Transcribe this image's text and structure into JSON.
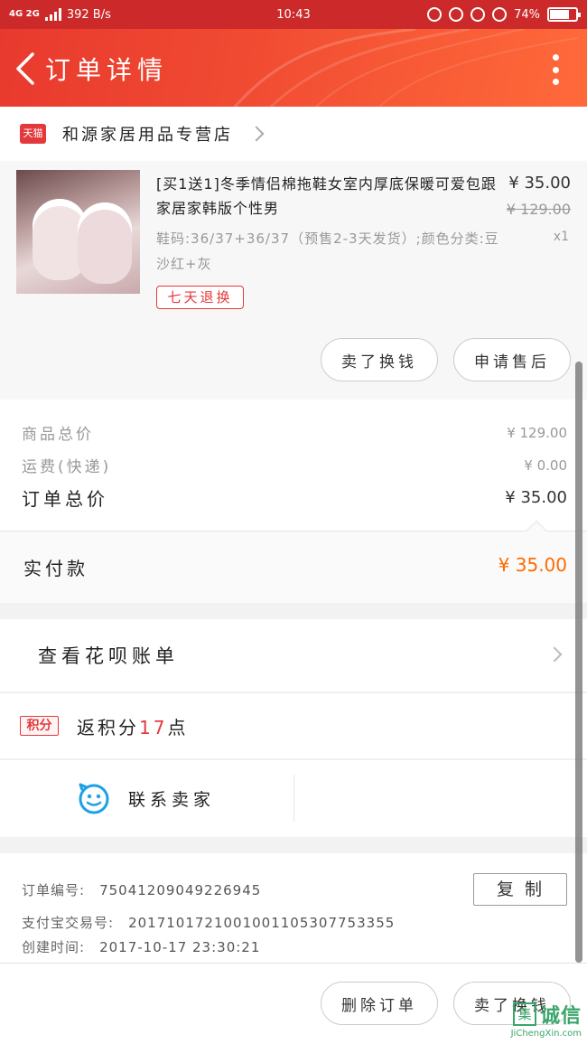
{
  "status_bar": {
    "network": "4G 2G",
    "speed": "392 B/s",
    "time": "10:43",
    "battery_text": "74%",
    "battery_level": 0.74
  },
  "header": {
    "title": "订单详情"
  },
  "shop": {
    "badge": "天猫",
    "name": "和源家居用品专营店"
  },
  "product": {
    "title": "[买1送1]冬季情侣棉拖鞋女室内厚底保暖可爱包跟家居家韩版个性男",
    "spec": "鞋码:36/37+36/37（预售2-3天发货）;颜色分类:豆沙红+灰",
    "price": "¥ 35.00",
    "original_price": "¥ 129.00",
    "quantity": "x1",
    "return_badge": "七天退换",
    "actions": [
      "卖了换钱",
      "申请售后"
    ]
  },
  "totals": {
    "goods_total_label": "商品总价",
    "goods_total": "¥ 129.00",
    "shipping_label": "运费(快递)",
    "shipping": "¥ 0.00",
    "order_total_label": "订单总价",
    "order_total": "¥ 35.00",
    "paid_label": "实付款",
    "paid": "¥ 35.00"
  },
  "huabei": {
    "label": "查看花呗账单"
  },
  "points": {
    "badge": "积分",
    "prefix": "返积分",
    "value": "17",
    "suffix": "点"
  },
  "contact": {
    "label": "联系卖家"
  },
  "order_info": {
    "order_no_label": "订单编号:",
    "order_no": "75041209049226945",
    "alipay_label": "支付宝交易号:",
    "alipay_no": "2017101721001001105307753355",
    "created_label": "创建时间:",
    "created": "2017-10-17 23:30:21",
    "copy_label": "复制"
  },
  "footer": {
    "delete_label": "删除订单",
    "resell_label": "卖了换钱"
  },
  "watermark": {
    "box": "集",
    "text": "诚信",
    "url": "JiChengXin.com"
  },
  "colors": {
    "header_red": "#e8392e",
    "tmall_red": "#e4393c",
    "paid_orange": "#ff6a00"
  }
}
